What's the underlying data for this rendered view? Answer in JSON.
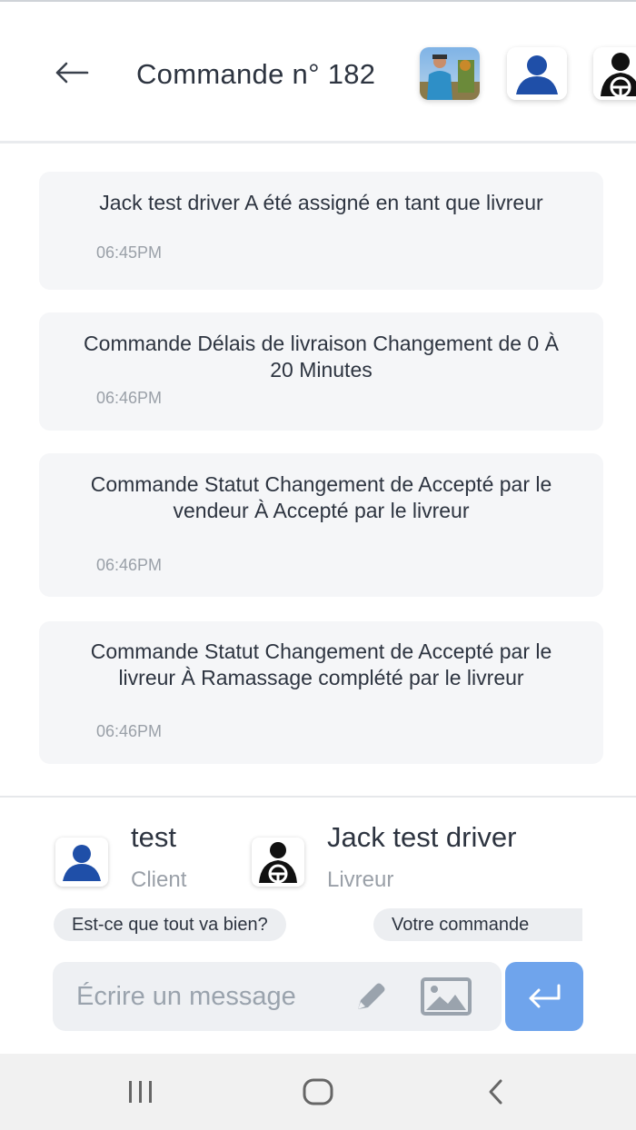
{
  "header": {
    "title": "Commande n° 182",
    "back_icon": "arrow-left-icon",
    "avatars": [
      "photo-avatar",
      "client-avatar-icon",
      "driver-avatar-icon"
    ]
  },
  "messages": [
    {
      "text": "Jack test driver  A été assigné en tant que livreur",
      "time": "06:45PM"
    },
    {
      "text": "Commande Délais de livraison Changement de 0 À 20 Minutes",
      "time": "06:46PM"
    },
    {
      "text": "Commande Statut Changement de Accepté par le vendeur À Accepté par le livreur",
      "time": "06:46PM"
    },
    {
      "text": "Commande Statut Changement de Accepté par le livreur À Ramassage complété par le livreur",
      "time": "06:46PM"
    }
  ],
  "participants": [
    {
      "name": "test",
      "role": "Client",
      "icon": "client-avatar-icon"
    },
    {
      "name": "Jack test driver",
      "role": "Livreur",
      "icon": "driver-avatar-icon"
    }
  ],
  "quick_replies": [
    "Est-ce que tout va bien?",
    "Votre commande"
  ],
  "composer": {
    "placeholder": "Écrire un message",
    "pencil_icon": "pencil-icon",
    "image_icon": "image-icon",
    "send_icon": "enter-icon"
  },
  "colors": {
    "accent": "#6fa4ec",
    "bubble": "#f5f6f8",
    "avatar_blue": "#1f4fa8"
  },
  "system_nav": [
    "recents-icon",
    "home-icon",
    "back-icon"
  ]
}
